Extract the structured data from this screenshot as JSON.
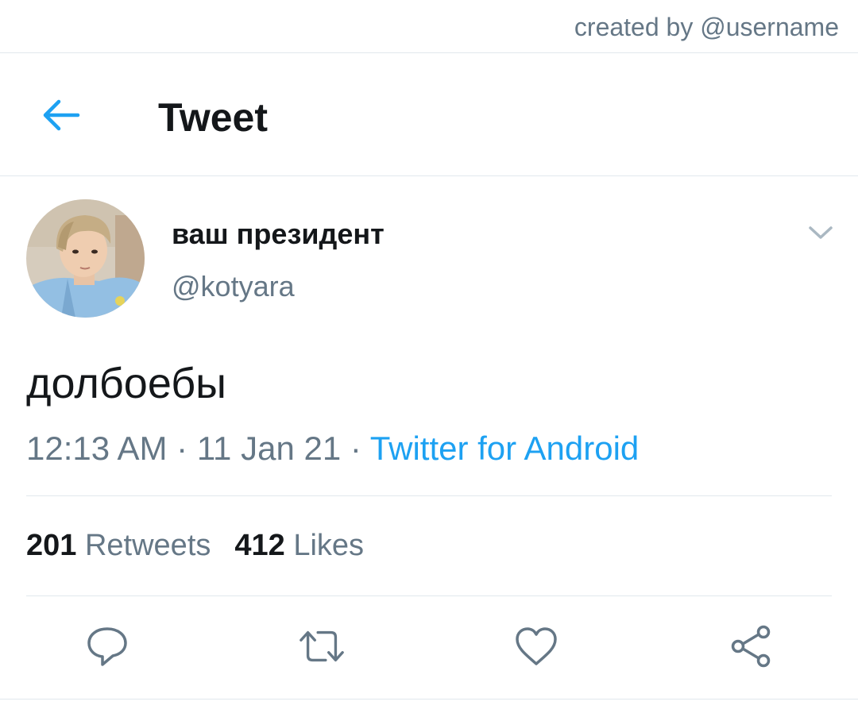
{
  "credit": "created by @username",
  "header": {
    "title": "Tweet",
    "back_icon": "arrow-left-icon"
  },
  "tweet": {
    "display_name": "ваш президент",
    "handle": "@kotyara",
    "text": "долбоебы",
    "time": "12:13 AM",
    "date": "11 Jan 21",
    "source": "Twitter for Android",
    "separator": "·",
    "retweets_count": "201",
    "retweets_label": "Retweets",
    "likes_count": "412",
    "likes_label": "Likes"
  },
  "actions": [
    "reply-icon",
    "retweet-icon",
    "like-icon",
    "share-icon"
  ],
  "colors": {
    "accent": "#1da1f2",
    "text_primary": "#14171a",
    "text_secondary": "#657786",
    "divider": "#e1e8ed"
  }
}
